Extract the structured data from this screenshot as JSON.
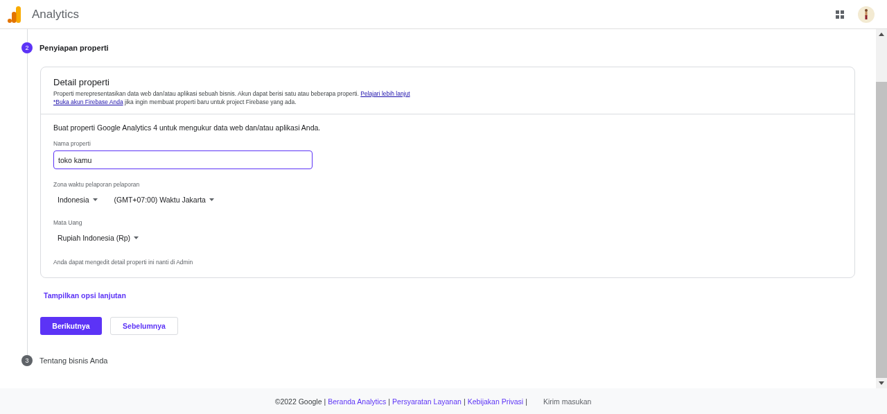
{
  "header": {
    "title": "Analytics"
  },
  "steps": [
    {
      "number": "2",
      "title": "Penyiapan properti",
      "active": true
    },
    {
      "number": "3",
      "title": "Tentang bisnis Anda",
      "active": false
    }
  ],
  "card": {
    "title": "Detail properti",
    "description": "Properti merepresentasikan data web dan/atau aplikasi sebuah bisnis. Akun dapat berisi satu atau beberapa properti.",
    "learn_more": "Pelajari lebih lanjut",
    "firebase_link": "*Buka akun Firebase Anda",
    "firebase_text": "jika ingin membuat properti baru untuk project Firebase yang ada.",
    "intro": "Buat properti Google Analytics 4 untuk mengukur data web dan/atau aplikasi Anda.",
    "name_label": "Nama properti",
    "name_value": "toko kamu",
    "timezone_label": "Zona waktu pelaporan pelaporan",
    "country": "Indonesia",
    "timezone": "(GMT+07:00) Waktu Jakarta",
    "currency_label": "Mata Uang",
    "currency": "Rupiah Indonesia (Rp)",
    "note": "Anda dapat mengedit detail properti ini nanti di Admin"
  },
  "advanced_link": "Tampilkan opsi lanjutan",
  "buttons": {
    "next": "Berikutnya",
    "back": "Sebelumnya"
  },
  "footer": [
    {
      "kind": "text",
      "text": "©2022 Google"
    },
    {
      "kind": "sep",
      "text": "|"
    },
    {
      "kind": "link",
      "text": "Beranda Analytics"
    },
    {
      "kind": "sep",
      "text": "|"
    },
    {
      "kind": "link",
      "text": "Persyaratan Layanan"
    },
    {
      "kind": "sep",
      "text": "|"
    },
    {
      "kind": "link",
      "text": "Kebijakan Privasi"
    },
    {
      "kind": "sep",
      "text": "|"
    },
    {
      "kind": "feedback",
      "text": "Kirim masukan"
    }
  ]
}
